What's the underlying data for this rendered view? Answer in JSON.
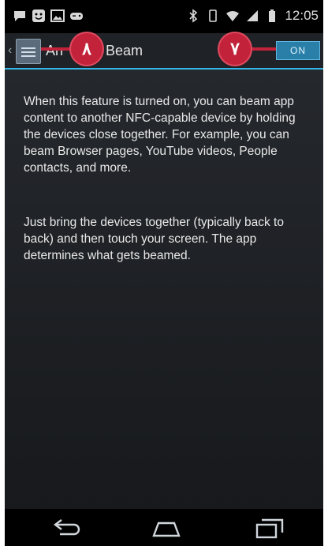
{
  "status_bar": {
    "time": "12:05",
    "left_icons": [
      "chat-icon",
      "smiley-icon",
      "image-icon",
      "gamepad-icon"
    ],
    "right_icons": [
      "bluetooth-icon",
      "rotate-icon",
      "wifi-icon",
      "signal-icon",
      "battery-icon"
    ]
  },
  "action_bar": {
    "title_prefix": "An",
    "title_suffix": "Beam",
    "toggle_label": "ON"
  },
  "callouts": {
    "first": "٨",
    "second": "٧"
  },
  "content": {
    "paragraph_1": "When this feature is turned on, you can beam app content to another NFC-capable device by holding the devices close together. For example, you can beam Browser pages, YouTube videos, People contacts, and more.",
    "paragraph_2": "Just bring the devices together (typically back to back) and then touch your screen. The app determines what gets beamed."
  },
  "nav_bar": {
    "buttons": [
      "back-icon",
      "home-icon",
      "recent-apps-icon"
    ]
  },
  "colors": {
    "accent": "#33b5e5",
    "callout": "#c2223a",
    "toggle_bg": "#2a7fa8"
  }
}
